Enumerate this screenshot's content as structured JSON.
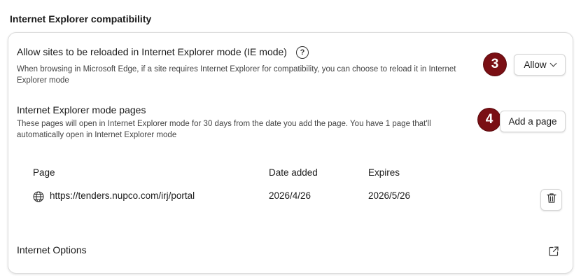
{
  "section": {
    "title": "Internet Explorer compatibility"
  },
  "ie_mode": {
    "title": "Allow sites to be reloaded in Internet Explorer mode (IE mode)",
    "help_glyph": "?",
    "desc_line1": "When browsing in Microsoft Edge, if a site requires Internet Explorer for compatibility, you can choose to reload it in Internet",
    "desc_line2": "Explorer mode",
    "badge": "3",
    "dropdown": {
      "selected": "Allow"
    }
  },
  "ie_pages": {
    "title": "Internet Explorer mode pages",
    "desc_line1": "These pages will open in Internet Explorer mode for 30 days from the date you add the page. You have 1 page that'll",
    "desc_line2": "automatically open in Internet Explorer mode",
    "badge": "4",
    "add_button": "Add a page",
    "table": {
      "headers": {
        "page": "Page",
        "date_added": "Date added",
        "expires": "Expires"
      },
      "rows": [
        {
          "url": "https://tenders.nupco.com/irj/portal",
          "date_added": "2026/4/26",
          "expires": "2026/5/26"
        }
      ]
    }
  },
  "internet_options": {
    "label": "Internet Options"
  },
  "colors": {
    "badge": "#7a0f14",
    "border": "#dcdcdc"
  },
  "icons": {
    "help": "help-icon",
    "globe": "globe-icon",
    "trash": "trash-icon",
    "external": "external-link-icon",
    "chevron": "chevron-down-icon"
  }
}
